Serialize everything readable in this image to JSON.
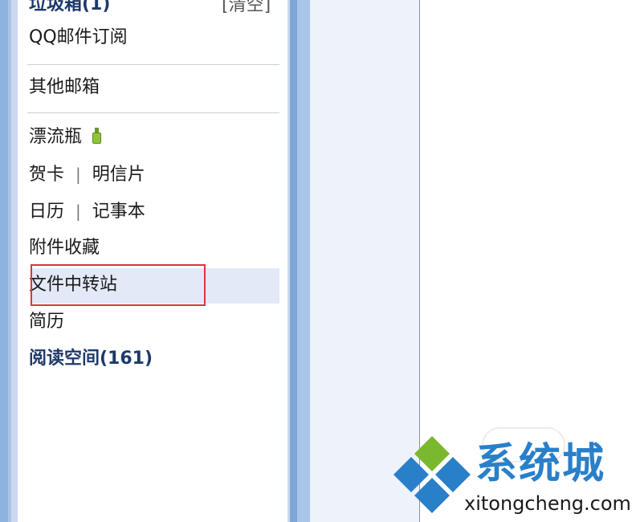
{
  "sidebar": {
    "top_partial": {
      "label": "垃圾箱(1)",
      "action": "[清空]"
    },
    "items_group1": [
      {
        "label": "QQ邮件订阅"
      }
    ],
    "items_group2": [
      {
        "label": "其他邮箱"
      }
    ],
    "drift_bottle": {
      "label": "漂流瓶",
      "icon": "bottle-icon",
      "icon_color": "#8fc43a"
    },
    "cards_row": {
      "left": "贺卡",
      "sep": "|",
      "right": "明信片"
    },
    "calendar_row": {
      "left": "日历",
      "sep": "|",
      "right": "记事本"
    },
    "attachments": {
      "label": "附件收藏"
    },
    "file_transfer": {
      "label": "文件中转站",
      "selected": true,
      "highlight_color": "#d9363e"
    },
    "resume": {
      "label": "简历"
    },
    "reading_space": {
      "label": "阅读空间(161)"
    }
  },
  "watermark": {
    "brand_cn": "系统城",
    "url": "xitongcheng.com",
    "colors": {
      "blue": "#2a7fc9",
      "green": "#7ab82e"
    }
  }
}
